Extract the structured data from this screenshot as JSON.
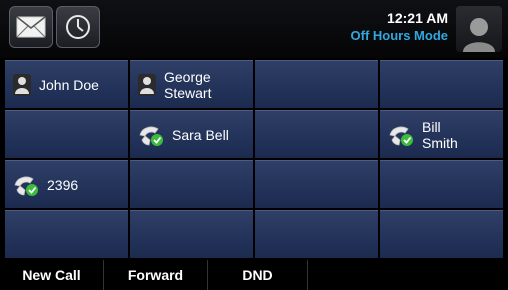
{
  "header": {
    "time": "12:21 AM",
    "mode": "Off Hours Mode",
    "icons": [
      "envelope-icon",
      "clock-icon",
      "user-avatar-icon"
    ]
  },
  "lines": {
    "row1": {
      "c1": {
        "icon": "contact-icon",
        "label": "John Doe"
      },
      "c2": {
        "icon": "contact-icon",
        "label_line1": "George",
        "label_line2": "Stewart"
      }
    },
    "row2": {
      "c2": {
        "icon": "handset-icon",
        "label": "Sara Bell"
      },
      "c4": {
        "icon": "handset-icon",
        "label_line1": "Bill",
        "label_line2": "Smith"
      }
    },
    "row3": {
      "c1": {
        "icon": "handset-icon",
        "label": "2396"
      }
    }
  },
  "softkeys": {
    "k1": "New Call",
    "k2": "Forward",
    "k3": "DND"
  },
  "colors": {
    "mode_text": "#2fa8e0",
    "cell_bg": "#223259",
    "handset_green": "#3dbb3d"
  }
}
